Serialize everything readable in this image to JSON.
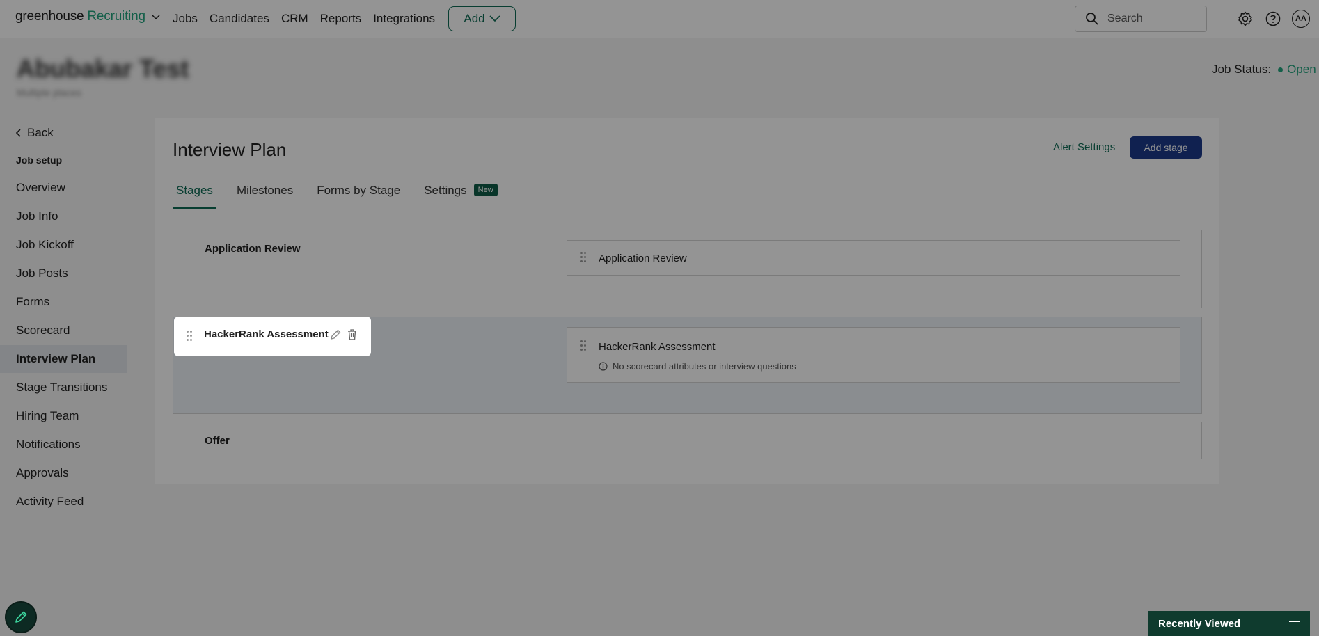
{
  "topnav": {
    "logo_main": "greenhouse",
    "logo_sub": "Recruiting",
    "links": [
      "Jobs",
      "Candidates",
      "CRM",
      "Reports",
      "Integrations"
    ],
    "add_label": "Add",
    "search_placeholder": "Search",
    "avatar_initials": "AA"
  },
  "job": {
    "title": "Abubakar Test",
    "subtitle": "Multiple places",
    "status_label": "Job Status:",
    "status_value": "Open"
  },
  "sidebar": {
    "back_label": "Back",
    "section_heading": "Job setup",
    "items": [
      {
        "label": "Overview"
      },
      {
        "label": "Job Info"
      },
      {
        "label": "Job Kickoff"
      },
      {
        "label": "Job Posts"
      },
      {
        "label": "Forms"
      },
      {
        "label": "Scorecard"
      },
      {
        "label": "Interview Plan"
      },
      {
        "label": "Stage Transitions"
      },
      {
        "label": "Hiring Team"
      },
      {
        "label": "Notifications"
      },
      {
        "label": "Approvals"
      },
      {
        "label": "Activity Feed"
      }
    ],
    "active_item": "Interview Plan"
  },
  "main": {
    "title": "Interview Plan",
    "alert_settings_label": "Alert Settings",
    "add_stage_label": "Add stage",
    "tabs": [
      {
        "label": "Stages"
      },
      {
        "label": "Milestones"
      },
      {
        "label": "Forms by Stage"
      },
      {
        "label": "Settings"
      }
    ],
    "settings_badge": "New",
    "stages": [
      {
        "name": "Application Review",
        "interview": "Application Review"
      },
      {
        "name": "HackerRank Assessment",
        "interview": "HackerRank Assessment",
        "note": "No scorecard attributes or interview questions"
      },
      {
        "name": "Offer"
      }
    ]
  },
  "bottom": {
    "recently_viewed_label": "Recently Viewed"
  },
  "colors": {
    "brand_green": "#24a47f",
    "dark_green": "#0f6b55",
    "primary_blue": "#1c3a8a"
  }
}
